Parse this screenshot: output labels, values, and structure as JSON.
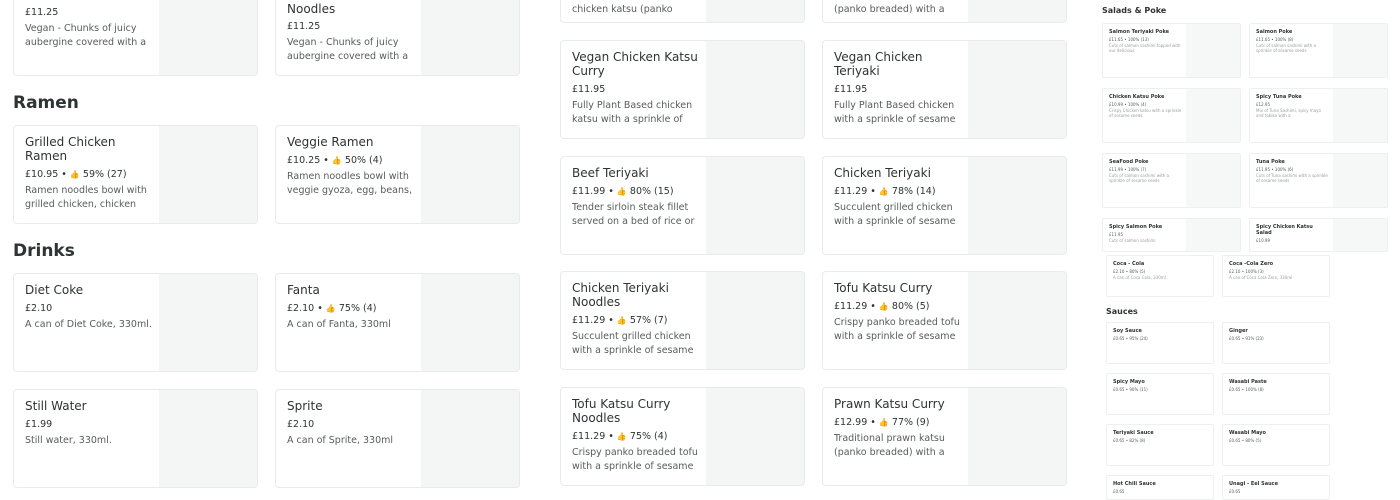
{
  "left": {
    "top_cards": [
      {
        "name": "",
        "price": "£11.25",
        "desc": "Vegan - Chunks of juicy aubergine covered with a"
      },
      {
        "name": "Noodles",
        "price": "£11.25",
        "desc": "Vegan - Chunks of juicy aubergine covered with a"
      }
    ],
    "ramen": {
      "heading": "Ramen",
      "items": [
        {
          "name": "Grilled Chicken Ramen",
          "price": "£10.95",
          "rating": "59% (27)",
          "desc": "Ramen noodles bowl with grilled chicken, chicken"
        },
        {
          "name": "Veggie Ramen",
          "price": "£10.25",
          "rating": "50% (4)",
          "desc": "Ramen noodles bowl with veggie gyoza, egg, beans,"
        }
      ]
    },
    "drinks": {
      "heading": "Drinks",
      "items": [
        {
          "name": "Diet Coke",
          "price": "£2.10",
          "rating": "",
          "desc": "A can of Diet Coke, 330ml."
        },
        {
          "name": "Fanta",
          "price": "£2.10",
          "rating": "75% (4)",
          "desc": "A can of Fanta, 330ml"
        },
        {
          "name": "Still Water",
          "price": "£1.99",
          "rating": "",
          "desc": "Still water, 330ml."
        },
        {
          "name": "Sprite",
          "price": "£2.10",
          "rating": "",
          "desc": "A can of Sprite, 330ml"
        }
      ]
    }
  },
  "middle": {
    "top_cards": [
      {
        "desc": "chicken katsu (panko"
      },
      {
        "desc": "(panko breaded) with a"
      }
    ],
    "items": [
      {
        "name": "Vegan Chicken Katsu Curry",
        "price": "£11.95",
        "rating": "",
        "desc": "Fully Plant Based chicken katsu with a sprinkle of"
      },
      {
        "name": "Vegan Chicken Teriyaki",
        "price": "£11.95",
        "rating": "",
        "desc": "Fully Plant Based chicken with a sprinkle of sesame"
      },
      {
        "name": "Beef Teriyaki",
        "price": "£11.99",
        "rating": "80% (15)",
        "desc": "Tender sirloin steak fillet served on a bed of rice or"
      },
      {
        "name": "Chicken Teriyaki",
        "price": "£11.29",
        "rating": "78% (14)",
        "desc": "Succulent grilled chicken with a sprinkle of sesame"
      },
      {
        "name": "Chicken Teriyaki Noodles",
        "price": "£11.29",
        "rating": "57% (7)",
        "desc": "Succulent grilled chicken with a sprinkle of sesame"
      },
      {
        "name": "Tofu Katsu Curry",
        "price": "£11.29",
        "rating": "80% (5)",
        "desc": "Crispy panko breaded tofu with a sprinkle of sesame"
      },
      {
        "name": "Tofu Katsu Curry Noodles",
        "price": "£11.29",
        "rating": "75% (4)",
        "desc": "Crispy panko breaded tofu with a sprinkle of sesame"
      },
      {
        "name": "Prawn Katsu Curry",
        "price": "£12.99",
        "rating": "77% (9)",
        "desc": "Traditional prawn katsu (panko breaded) with a"
      }
    ]
  },
  "right": {
    "salads": {
      "heading": "Salads & Poke",
      "items": [
        {
          "name": "Salmon Teriyaki Poke",
          "price": "£11.65 • 100% (13)",
          "desc": "Cuts of salmon sashimi topped with our delicious"
        },
        {
          "name": "Salmon Poke",
          "price": "£11.65 • 100% (8)",
          "desc": "Cuts of salmon sashimi with a sprinkle of sesame seeds"
        },
        {
          "name": "Chicken Katsu Poke",
          "price": "£10.99 • 100% (4)",
          "desc": "Crispy Chicken katsu with a sprinkle of sesame seeds"
        },
        {
          "name": "Spicy Tuna Poke",
          "price": "£12.95",
          "desc": "Mix of Tuna Sashimi, spicy mayo and tobiko with a"
        },
        {
          "name": "SeaFood Poke",
          "price": "£11.99 • 100% (7)",
          "desc": "Cuts of salmon sashimi with a sprinkle of sesame seeds"
        },
        {
          "name": "Tuna Poke",
          "price": "£11.95 • 100% (6)",
          "desc": "Cuts of Tuna sashimi with a sprinkle of sesame seeds"
        },
        {
          "name": "Spicy Salmon Poke",
          "price": "£11.95",
          "desc": "Cuts of salmon sashimi"
        },
        {
          "name": "Spicy Chicken Katsu Salad",
          "price": "£10.99",
          "desc": ""
        },
        {
          "name": "Coca - Cola",
          "price": "£2.10 • 80% (5)",
          "desc": "A can of Coca Cola, 330ml"
        },
        {
          "name": "Coca -Cola Zero",
          "price": "£2.10 • 100% (3)",
          "desc": "A can of Coca Cola Zero, 330ml"
        }
      ]
    },
    "sauces": {
      "heading": "Sauces",
      "items": [
        {
          "name": "Soy Sauce",
          "price": "£0.65 • 95% (24)"
        },
        {
          "name": "Ginger",
          "price": "£0.65 • 91% (23)"
        },
        {
          "name": "Spicy Mayo",
          "price": "£0.65 • 90% (11)"
        },
        {
          "name": "Wasabi Paste",
          "price": "£0.65 • 100% (8)"
        },
        {
          "name": "Teriyaki Sauce",
          "price": "£0.65 • 82% (8)"
        },
        {
          "name": "Wasabi Mayo",
          "price": "£0.65 • 80% (5)"
        },
        {
          "name": "Hot Chili Sauce",
          "price": "£0.65"
        },
        {
          "name": "Unagi - Eel Sauce",
          "price": "£0.65"
        }
      ]
    }
  }
}
